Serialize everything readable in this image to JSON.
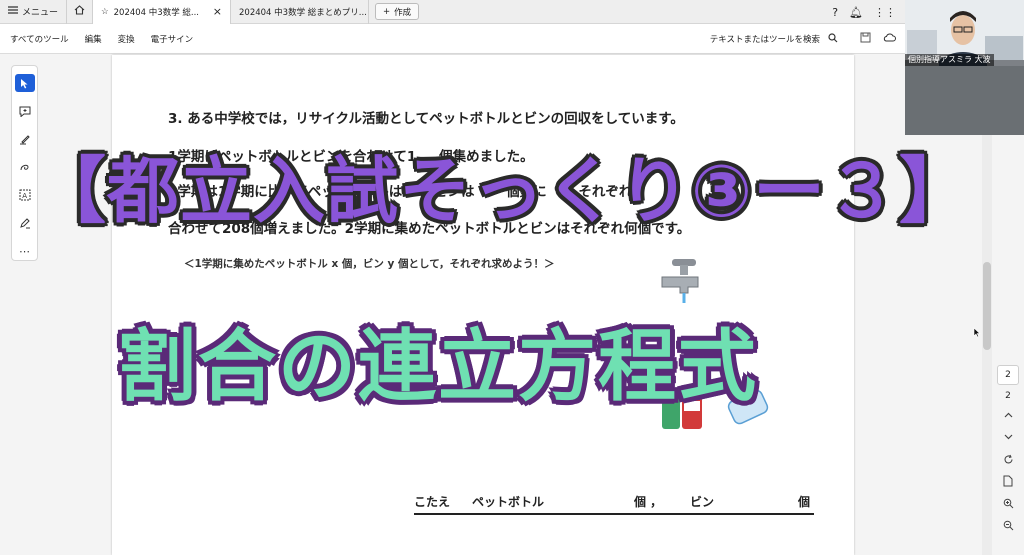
{
  "tabbar": {
    "menu_label": "メニュー",
    "tabs": [
      {
        "label": "202404  中3数学  総..."
      },
      {
        "label": "202404  中3数学  総まとめプリ..."
      }
    ],
    "create_label": "作成"
  },
  "toolbar": {
    "items": [
      "すべてのツール",
      "編集",
      "変換",
      "電子サイン"
    ],
    "search_label": "テキストまたはツールを検索"
  },
  "document": {
    "question_line1": "3. ある中学校では，リサイクル活動としてペットボトルとビンの回収をしています。",
    "question_line2": "1学期はペットボトルとビンを合わせて1 　 個集めました。",
    "question_line3": "2学期は1学期に比べてペットボトルは　　 ビンは　　 個数に　　 それぞれ　",
    "question_line4": "合わせて208個増えました。2学期に集めたペットボトルとビンはそれぞれ何個です。",
    "hint": "＜1学期に集めたペットボトル x 個，ビン y 個として，それぞれ求めよう！＞",
    "answer_label": "こたえ",
    "answer_pet": "ペットボトル",
    "answer_unit1": "個 ，",
    "answer_bin": "ビン",
    "answer_unit2": "個"
  },
  "overlay": {
    "title1": "【都立入試そっくり③ー３】",
    "title2": "割合の連立方程式"
  },
  "page_nav": {
    "current_page": "2",
    "total_pages": "2"
  },
  "webcam": {
    "label": "個別指導アスミラ 大波"
  },
  "colors": {
    "title1_fill": "#8a55d8",
    "title2_fill": "#6fe0b2",
    "selected_tool": "#1e5fd8"
  }
}
